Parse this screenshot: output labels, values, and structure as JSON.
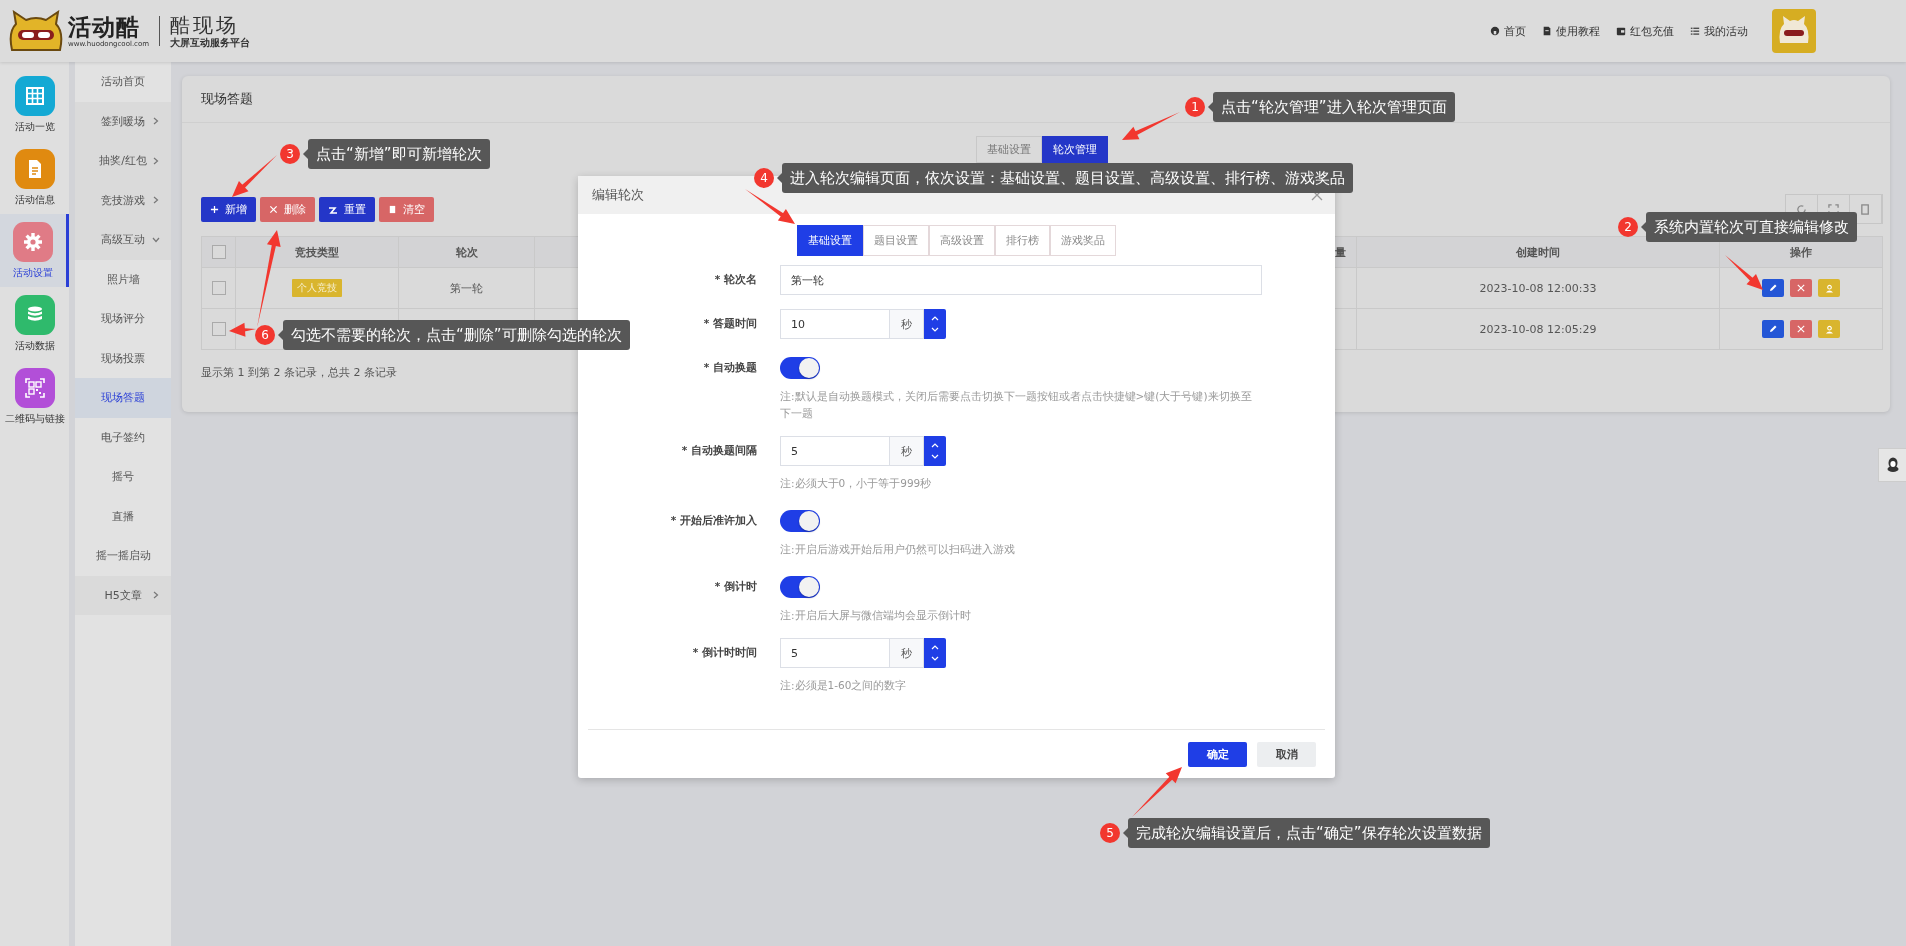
{
  "header": {
    "brand": "活动酷",
    "url": "www.huodongcool.com",
    "product": "酷现场",
    "slogan": "大屏互动服务平台",
    "nav": [
      {
        "label": "首页",
        "kind": "home"
      },
      {
        "label": "使用教程",
        "kind": "book"
      },
      {
        "label": "红包充值",
        "kind": "wallet"
      },
      {
        "label": "我的活动",
        "kind": "list"
      }
    ]
  },
  "sidebar": {
    "items": [
      {
        "label": "活动一览",
        "kind": "grid",
        "color": "#14a9d4",
        "selected": false
      },
      {
        "label": "活动信息",
        "kind": "document",
        "color": "#e08a10",
        "selected": false
      },
      {
        "label": "活动设置",
        "kind": "gear",
        "color": "#e07b86",
        "selected": true
      },
      {
        "label": "活动数据",
        "kind": "database",
        "color": "#2fba6c",
        "selected": false
      },
      {
        "label": "二维码与链接",
        "kind": "qrcode",
        "color": "#b24fd8",
        "selected": false
      }
    ]
  },
  "submenu": {
    "items": [
      {
        "label": "活动首页",
        "selected": false
      },
      {
        "label": "签到暖场",
        "selected": false,
        "expanded": false
      },
      {
        "label": "抽奖/红包",
        "selected": false,
        "expanded": false
      },
      {
        "label": "竞技游戏",
        "selected": false,
        "expanded": false
      },
      {
        "label": "高级互动",
        "selected": false,
        "expanded": true,
        "children": [
          {
            "label": "照片墙",
            "selected": false
          },
          {
            "label": "现场评分",
            "selected": false
          },
          {
            "label": "现场投票",
            "selected": false
          },
          {
            "label": "现场答题",
            "selected": true
          },
          {
            "label": "电子签约",
            "selected": false
          },
          {
            "label": "摇号",
            "selected": false
          },
          {
            "label": "直播",
            "selected": false
          },
          {
            "label": "摇一摇启动",
            "selected": false
          }
        ]
      },
      {
        "label": "H5文章",
        "selected": false,
        "expanded": false
      }
    ]
  },
  "page": {
    "title": "现场答题",
    "tabs": [
      {
        "label": "基础设置",
        "selected": false
      },
      {
        "label": "轮次管理",
        "selected": true
      }
    ],
    "toolbar": [
      {
        "label": "新增",
        "kind": "add"
      },
      {
        "label": "删除",
        "kind": "delete"
      },
      {
        "label": "重置",
        "kind": "reset"
      },
      {
        "label": "清空",
        "kind": "clear"
      }
    ],
    "table": {
      "select_all": {
        "checked": false
      },
      "columns": [
        "竞技类型",
        "轮次",
        "量",
        "创建时间",
        "操作"
      ],
      "rows": [
        {
          "checked": false,
          "type": "个人竞技",
          "round": "第一轮",
          "created": "2023-10-08 12:00:33"
        },
        {
          "checked": false,
          "created": "2023-10-08 12:05:29"
        }
      ]
    },
    "footer": "显示第 1 到第 2 条记录，总共 2 条记录"
  },
  "modal": {
    "title": "编辑轮次",
    "tabs": [
      {
        "label": "基础设置",
        "selected": true
      },
      {
        "label": "题目设置",
        "selected": false
      },
      {
        "label": "高级设置",
        "selected": false
      },
      {
        "label": "排行榜",
        "selected": false
      },
      {
        "label": "游戏奖品",
        "selected": false
      }
    ],
    "fields": [
      {
        "label": "* 轮次名",
        "kind": "text",
        "value": "第一轮"
      },
      {
        "label": "* 答题时间",
        "kind": "number",
        "value": "10",
        "unit": "秒"
      },
      {
        "label": "* 自动换题",
        "kind": "switch",
        "on": true,
        "note": "注:默认是自动换题模式，关闭后需要点击切换下一题按钮或者点击快捷键>键(大于号键)来切换至下一题"
      },
      {
        "label": "* 自动换题间隔",
        "kind": "number",
        "value": "5",
        "unit": "秒",
        "note": "注:必须大于0，小于等于999秒"
      },
      {
        "label": "* 开始后准许加入",
        "kind": "switch",
        "on": true,
        "note": "注:开启后游戏开始后用户仍然可以扫码进入游戏"
      },
      {
        "label": "* 倒计时",
        "kind": "switch",
        "on": true,
        "note": "注:开启后大屏与微信端均会显示倒计时"
      },
      {
        "label": "* 倒计时时间",
        "kind": "number",
        "value": "5",
        "unit": "秒",
        "note": "注:必须是1-60之间的数字"
      }
    ],
    "buttons": [
      {
        "label": "确定",
        "kind": "primary"
      },
      {
        "label": "取消",
        "kind": "default"
      }
    ]
  },
  "annotations": [
    {
      "number": "1",
      "text": "点击“轮次管理”进入轮次管理页面"
    },
    {
      "number": "2",
      "text": "系统内置轮次可直接编辑修改"
    },
    {
      "number": "3",
      "text": "点击“新增”即可新增轮次"
    },
    {
      "number": "4",
      "text": "进入轮次编辑页面，依次设置：基础设置、题目设置、高级设置、排行榜、游戏奖品"
    },
    {
      "number": "5",
      "text": "完成轮次编辑设置后，点击“确定”保存轮次设置数据"
    },
    {
      "number": "6",
      "text": "勾选不需要的轮次，点击“删除”可删除勾选的轮次"
    }
  ]
}
